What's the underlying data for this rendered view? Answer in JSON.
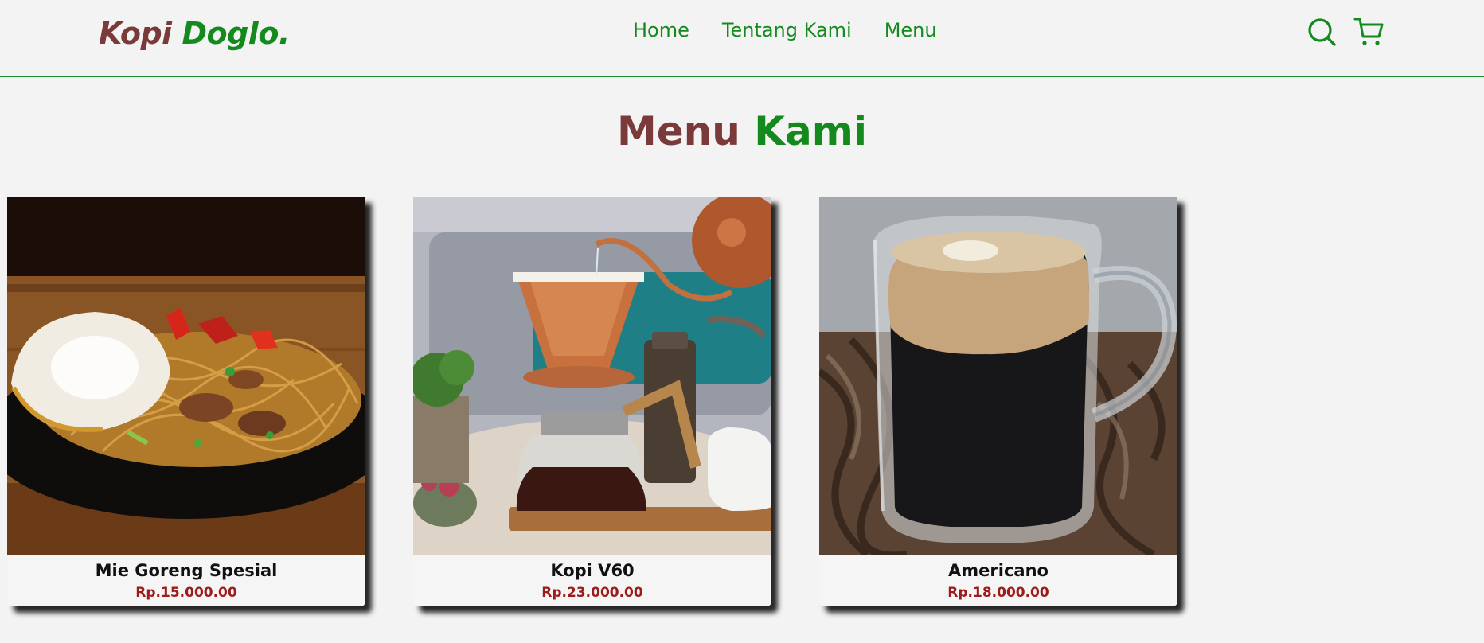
{
  "navbar": {
    "logo_part1": "Kopi",
    "logo_part2": "Doglo.",
    "links": [
      "Home",
      "Tentang Kami",
      "Menu"
    ],
    "icons": [
      "search-icon",
      "cart-icon"
    ]
  },
  "menu": {
    "title_part1": "Menu",
    "title_part2": "Kami",
    "items": [
      {
        "name": "Mie Goreng Spesial",
        "price": "Rp.15.000.00",
        "image": "fried-noodles-photo"
      },
      {
        "name": "Kopi V60",
        "price": "Rp.23.000.00",
        "image": "v60-pour-over-photo"
      },
      {
        "name": "Americano",
        "price": "Rp.18.000.00",
        "image": "americano-glass-photo"
      }
    ]
  },
  "colors": {
    "brand_brown": "#7a3a3a",
    "brand_green": "#148a1e",
    "price_red": "#9c1b1b",
    "background": "#f3f3f3"
  }
}
